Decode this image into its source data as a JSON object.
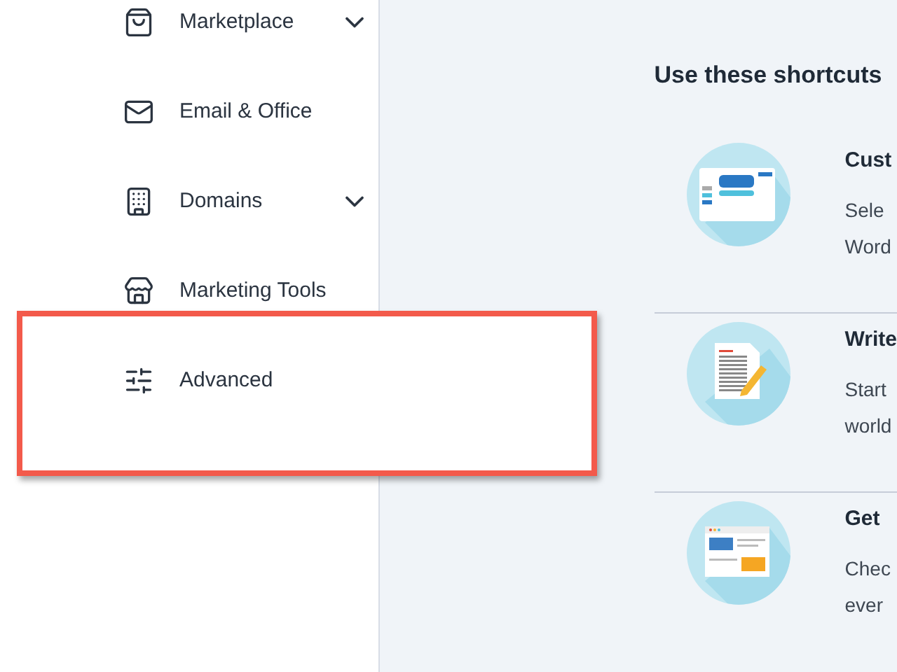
{
  "sidebar": {
    "items": [
      {
        "label": "Marketplace",
        "kind": "bag",
        "has_submenu": true,
        "highlighted": false
      },
      {
        "label": "Email & Office",
        "kind": "mail",
        "has_submenu": false,
        "highlighted": false
      },
      {
        "label": "Domains",
        "kind": "building",
        "has_submenu": true,
        "highlighted": false
      },
      {
        "label": "Marketing Tools",
        "kind": "store",
        "has_submenu": false,
        "highlighted": false
      },
      {
        "label": "Advanced",
        "kind": "sliders",
        "has_submenu": false,
        "highlighted": true
      }
    ]
  },
  "main": {
    "heading": "Use these shortcuts",
    "shortcuts": [
      {
        "kind": "editor",
        "title": "Cust",
        "lines": [
          "Sele",
          "Word"
        ]
      },
      {
        "kind": "document",
        "title": "Write",
        "lines": [
          "Start",
          "world"
        ]
      },
      {
        "kind": "browser",
        "title": "Get",
        "lines": [
          "Chec",
          "ever"
        ]
      }
    ]
  }
}
